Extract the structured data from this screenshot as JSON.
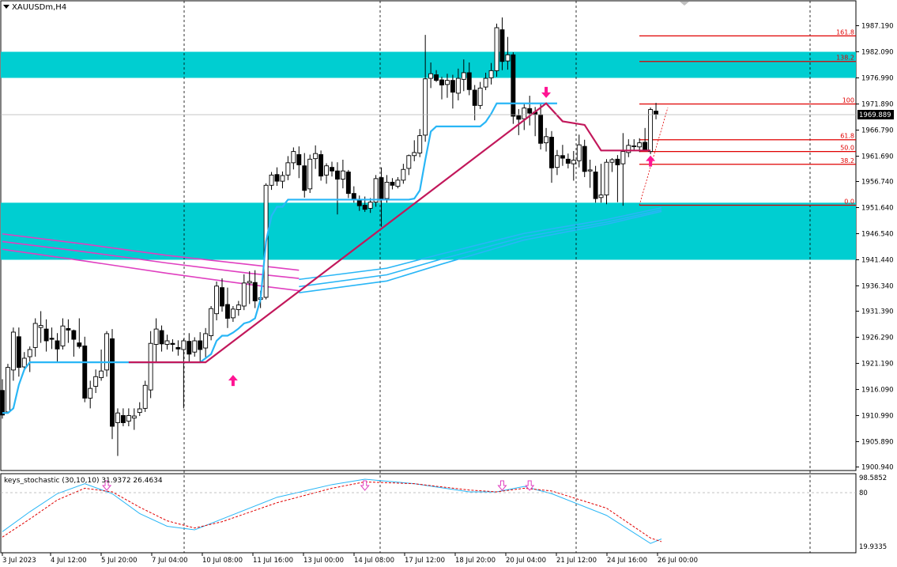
{
  "chart": {
    "symbol_title": "XAUUSDm,H4",
    "current_price": "1969.889",
    "y_ticks": [
      "1987.190",
      "1982.090",
      "1976.990",
      "1971.890",
      "1966.790",
      "1961.690",
      "1956.740",
      "1951.640",
      "1946.540",
      "1941.440",
      "1936.340",
      "1931.390",
      "1926.290",
      "1921.190",
      "1916.090",
      "1910.990",
      "1905.890",
      "1900.940"
    ],
    "fib_labels": [
      "161.8",
      "138.2",
      "100",
      "61.8",
      "50.0",
      "38.2",
      "0.0"
    ]
  },
  "indicator": {
    "title": "keys_stochastic (30,10,10) 31.9372 26.4634",
    "y_top": "98.5852",
    "y_mid": "80",
    "y_bottom": "19.9335"
  },
  "x_axis": {
    "labels": [
      "3 Jul 2023",
      "4 Jul 12:00",
      "5 Jul 20:00",
      "7 Jul 04:00",
      "10 Jul 08:00",
      "11 Jul 16:00",
      "13 Jul 00:00",
      "14 Jul 08:00",
      "17 Jul 12:00",
      "18 Jul 20:00",
      "20 Jul 04:00",
      "21 Jul 12:00",
      "24 Jul 16:00",
      "26 Jul 00:00"
    ]
  },
  "colors": {
    "zone": "#00CED1",
    "support": "#29B6F6",
    "resistance": "#C2185B",
    "fib": "#E00000",
    "ribbon": "#E040C0",
    "arrow": "#FF1493"
  },
  "chart_data": {
    "type": "candlestick",
    "y_range": [
      1900.94,
      1990.0
    ],
    "zones": [
      [
        1976.99,
        1982.09
      ],
      [
        1941.44,
        1952.59
      ]
    ],
    "fib_levels": [
      1985.2,
      1980.2,
      1971.89,
      1964.9,
      1962.6,
      1960.1,
      1952.1
    ],
    "candles": [
      {
        "o": 1915.9,
        "h": 1918.1,
        "l": 1910.4,
        "c": 1911.1
      },
      {
        "o": 1911.7,
        "h": 1921.1,
        "l": 1911.5,
        "c": 1920.4
      },
      {
        "o": 1919.9,
        "h": 1928.2,
        "l": 1917.8,
        "c": 1927.3
      },
      {
        "o": 1926.4,
        "h": 1928.2,
        "l": 1918.6,
        "c": 1920.4
      },
      {
        "o": 1920.5,
        "h": 1923.4,
        "l": 1919.7,
        "c": 1922.2
      },
      {
        "o": 1922.5,
        "h": 1924.5,
        "l": 1919.5,
        "c": 1923.9
      },
      {
        "o": 1924.3,
        "h": 1930.0,
        "l": 1922.5,
        "c": 1929.0
      },
      {
        "o": 1928.2,
        "h": 1931.4,
        "l": 1925.2,
        "c": 1928.6
      },
      {
        "o": 1927.9,
        "h": 1929.8,
        "l": 1923.5,
        "c": 1925.6
      },
      {
        "o": 1926.1,
        "h": 1928.2,
        "l": 1924.0,
        "c": 1925.9
      },
      {
        "o": 1925.6,
        "h": 1927.1,
        "l": 1921.4,
        "c": 1924.0
      },
      {
        "o": 1924.6,
        "h": 1930.0,
        "l": 1923.9,
        "c": 1928.5
      },
      {
        "o": 1928.0,
        "h": 1929.8,
        "l": 1925.2,
        "c": 1927.7
      },
      {
        "o": 1927.6,
        "h": 1927.8,
        "l": 1922.5,
        "c": 1925.9
      },
      {
        "o": 1925.2,
        "h": 1930.0,
        "l": 1924.1,
        "c": 1924.5
      },
      {
        "o": 1924.6,
        "h": 1926.4,
        "l": 1913.6,
        "c": 1914.4
      },
      {
        "o": 1914.4,
        "h": 1917.8,
        "l": 1912.4,
        "c": 1916.3
      },
      {
        "o": 1916.7,
        "h": 1920.0,
        "l": 1915.4,
        "c": 1918.6
      },
      {
        "o": 1918.4,
        "h": 1923.9,
        "l": 1917.8,
        "c": 1919.7
      },
      {
        "o": 1919.9,
        "h": 1927.5,
        "l": 1918.6,
        "c": 1927.0
      },
      {
        "o": 1926.0,
        "h": 1927.9,
        "l": 1906.4,
        "c": 1908.9
      },
      {
        "o": 1909.6,
        "h": 1912.4,
        "l": 1903.1,
        "c": 1911.5
      },
      {
        "o": 1911.0,
        "h": 1912.4,
        "l": 1908.9,
        "c": 1909.6
      },
      {
        "o": 1909.9,
        "h": 1912.4,
        "l": 1908.9,
        "c": 1911.0
      },
      {
        "o": 1910.5,
        "h": 1912.4,
        "l": 1908.2,
        "c": 1910.9
      },
      {
        "o": 1911.6,
        "h": 1913.6,
        "l": 1910.9,
        "c": 1912.3
      },
      {
        "o": 1912.4,
        "h": 1917.8,
        "l": 1911.7,
        "c": 1916.9
      },
      {
        "o": 1916.0,
        "h": 1927.5,
        "l": 1914.4,
        "c": 1925.1
      },
      {
        "o": 1924.9,
        "h": 1930.0,
        "l": 1921.4,
        "c": 1927.9
      },
      {
        "o": 1927.6,
        "h": 1928.6,
        "l": 1923.5,
        "c": 1925.0
      },
      {
        "o": 1924.9,
        "h": 1926.8,
        "l": 1923.9,
        "c": 1925.6
      },
      {
        "o": 1925.1,
        "h": 1925.9,
        "l": 1923.5,
        "c": 1924.9
      },
      {
        "o": 1924.3,
        "h": 1925.7,
        "l": 1922.7,
        "c": 1924.0
      },
      {
        "o": 1923.9,
        "h": 1926.0,
        "l": 1912.4,
        "c": 1925.6
      },
      {
        "o": 1925.5,
        "h": 1927.1,
        "l": 1921.4,
        "c": 1923.0
      },
      {
        "o": 1923.4,
        "h": 1926.3,
        "l": 1922.5,
        "c": 1925.6
      },
      {
        "o": 1925.6,
        "h": 1927.3,
        "l": 1921.5,
        "c": 1923.9
      },
      {
        "o": 1924.2,
        "h": 1928.1,
        "l": 1922.4,
        "c": 1927.0
      },
      {
        "o": 1926.6,
        "h": 1932.4,
        "l": 1925.7,
        "c": 1931.9
      },
      {
        "o": 1930.9,
        "h": 1937.2,
        "l": 1929.6,
        "c": 1936.3
      },
      {
        "o": 1936.0,
        "h": 1937.8,
        "l": 1931.3,
        "c": 1932.4
      },
      {
        "o": 1932.7,
        "h": 1936.0,
        "l": 1928.1,
        "c": 1930.0
      },
      {
        "o": 1930.1,
        "h": 1932.4,
        "l": 1929.3,
        "c": 1931.8
      },
      {
        "o": 1931.7,
        "h": 1933.4,
        "l": 1930.5,
        "c": 1932.6
      },
      {
        "o": 1932.4,
        "h": 1938.6,
        "l": 1931.6,
        "c": 1936.9
      },
      {
        "o": 1936.9,
        "h": 1939.2,
        "l": 1932.8,
        "c": 1937.2
      },
      {
        "o": 1937.0,
        "h": 1939.4,
        "l": 1932.0,
        "c": 1933.4
      },
      {
        "o": 1933.7,
        "h": 1935.4,
        "l": 1932.0,
        "c": 1934.0
      },
      {
        "o": 1934.1,
        "h": 1956.4,
        "l": 1933.7,
        "c": 1956.0
      },
      {
        "o": 1956.0,
        "h": 1958.6,
        "l": 1955.1,
        "c": 1958.0
      },
      {
        "o": 1958.1,
        "h": 1959.5,
        "l": 1955.9,
        "c": 1956.8
      },
      {
        "o": 1956.8,
        "h": 1958.7,
        "l": 1955.4,
        "c": 1957.9
      },
      {
        "o": 1958.0,
        "h": 1961.7,
        "l": 1957.0,
        "c": 1960.4
      },
      {
        "o": 1960.4,
        "h": 1963.4,
        "l": 1959.1,
        "c": 1962.6
      },
      {
        "o": 1962.0,
        "h": 1963.6,
        "l": 1957.4,
        "c": 1960.0
      },
      {
        "o": 1959.8,
        "h": 1962.3,
        "l": 1953.6,
        "c": 1955.0
      },
      {
        "o": 1955.3,
        "h": 1962.0,
        "l": 1954.5,
        "c": 1961.1
      },
      {
        "o": 1961.2,
        "h": 1963.8,
        "l": 1959.2,
        "c": 1962.2
      },
      {
        "o": 1962.0,
        "h": 1962.8,
        "l": 1956.9,
        "c": 1957.8
      },
      {
        "o": 1958.0,
        "h": 1960.3,
        "l": 1956.3,
        "c": 1959.8
      },
      {
        "o": 1959.5,
        "h": 1960.6,
        "l": 1957.7,
        "c": 1958.8
      },
      {
        "o": 1958.8,
        "h": 1960.5,
        "l": 1950.3,
        "c": 1957.2
      },
      {
        "o": 1957.2,
        "h": 1961.0,
        "l": 1955.4,
        "c": 1958.8
      },
      {
        "o": 1958.6,
        "h": 1959.0,
        "l": 1953.5,
        "c": 1954.4
      },
      {
        "o": 1954.4,
        "h": 1955.8,
        "l": 1952.6,
        "c": 1953.2
      },
      {
        "o": 1953.1,
        "h": 1954.0,
        "l": 1951.0,
        "c": 1952.0
      },
      {
        "o": 1952.1,
        "h": 1953.8,
        "l": 1950.8,
        "c": 1951.3
      },
      {
        "o": 1951.5,
        "h": 1953.5,
        "l": 1950.6,
        "c": 1952.7
      },
      {
        "o": 1952.7,
        "h": 1958.0,
        "l": 1951.8,
        "c": 1957.3
      },
      {
        "o": 1957.5,
        "h": 1959.5,
        "l": 1947.9,
        "c": 1953.4
      },
      {
        "o": 1953.4,
        "h": 1958.0,
        "l": 1952.6,
        "c": 1956.6
      },
      {
        "o": 1956.6,
        "h": 1957.4,
        "l": 1955.2,
        "c": 1956.0
      },
      {
        "o": 1955.8,
        "h": 1957.6,
        "l": 1955.4,
        "c": 1957.0
      },
      {
        "o": 1957.0,
        "h": 1960.2,
        "l": 1956.3,
        "c": 1959.1
      },
      {
        "o": 1959.3,
        "h": 1962.0,
        "l": 1958.0,
        "c": 1961.8
      },
      {
        "o": 1961.8,
        "h": 1964.8,
        "l": 1960.7,
        "c": 1962.4
      },
      {
        "o": 1962.3,
        "h": 1967.0,
        "l": 1961.5,
        "c": 1965.7
      },
      {
        "o": 1965.8,
        "h": 1985.4,
        "l": 1964.5,
        "c": 1976.8
      },
      {
        "o": 1976.9,
        "h": 1980.0,
        "l": 1975.0,
        "c": 1977.8
      },
      {
        "o": 1977.6,
        "h": 1978.5,
        "l": 1976.2,
        "c": 1976.5
      },
      {
        "o": 1976.6,
        "h": 1977.2,
        "l": 1972.8,
        "c": 1975.6
      },
      {
        "o": 1975.7,
        "h": 1977.8,
        "l": 1973.1,
        "c": 1976.5
      },
      {
        "o": 1976.5,
        "h": 1977.6,
        "l": 1971.0,
        "c": 1974.2
      },
      {
        "o": 1974.0,
        "h": 1978.8,
        "l": 1972.6,
        "c": 1976.9
      },
      {
        "o": 1976.7,
        "h": 1980.6,
        "l": 1974.4,
        "c": 1978.0
      },
      {
        "o": 1978.0,
        "h": 1980.0,
        "l": 1973.6,
        "c": 1974.7
      },
      {
        "o": 1974.6,
        "h": 1975.6,
        "l": 1968.7,
        "c": 1971.6
      },
      {
        "o": 1971.6,
        "h": 1976.2,
        "l": 1970.9,
        "c": 1975.0
      },
      {
        "o": 1975.2,
        "h": 1978.0,
        "l": 1974.6,
        "c": 1976.9
      },
      {
        "o": 1977.0,
        "h": 1979.9,
        "l": 1975.7,
        "c": 1978.4
      },
      {
        "o": 1978.4,
        "h": 1987.6,
        "l": 1977.2,
        "c": 1986.8
      },
      {
        "o": 1986.4,
        "h": 1988.8,
        "l": 1978.5,
        "c": 1980.2
      },
      {
        "o": 1980.3,
        "h": 1985.0,
        "l": 1978.6,
        "c": 1981.5
      },
      {
        "o": 1981.5,
        "h": 1982.0,
        "l": 1968.0,
        "c": 1969.5
      },
      {
        "o": 1969.6,
        "h": 1970.9,
        "l": 1965.8,
        "c": 1968.9
      },
      {
        "o": 1969.0,
        "h": 1972.1,
        "l": 1966.8,
        "c": 1971.1
      },
      {
        "o": 1971.0,
        "h": 1973.5,
        "l": 1967.7,
        "c": 1970.1
      },
      {
        "o": 1970.3,
        "h": 1971.3,
        "l": 1965.6,
        "c": 1969.8
      },
      {
        "o": 1969.8,
        "h": 1972.0,
        "l": 1963.0,
        "c": 1964.2
      },
      {
        "o": 1964.3,
        "h": 1967.2,
        "l": 1962.6,
        "c": 1965.5
      },
      {
        "o": 1965.4,
        "h": 1966.6,
        "l": 1956.5,
        "c": 1959.4
      },
      {
        "o": 1959.5,
        "h": 1962.9,
        "l": 1958.0,
        "c": 1961.8
      },
      {
        "o": 1961.8,
        "h": 1963.9,
        "l": 1959.8,
        "c": 1961.3
      },
      {
        "o": 1961.1,
        "h": 1962.2,
        "l": 1959.3,
        "c": 1960.3
      },
      {
        "o": 1960.2,
        "h": 1962.7,
        "l": 1956.9,
        "c": 1960.9
      },
      {
        "o": 1960.8,
        "h": 1965.9,
        "l": 1959.5,
        "c": 1963.9
      },
      {
        "o": 1963.6,
        "h": 1964.9,
        "l": 1957.6,
        "c": 1958.7
      },
      {
        "o": 1958.8,
        "h": 1961.0,
        "l": 1955.5,
        "c": 1959.0
      },
      {
        "o": 1958.6,
        "h": 1959.8,
        "l": 1952.6,
        "c": 1953.4
      },
      {
        "o": 1953.6,
        "h": 1960.2,
        "l": 1952.6,
        "c": 1954.1
      },
      {
        "o": 1954.1,
        "h": 1961.1,
        "l": 1952.3,
        "c": 1960.5
      },
      {
        "o": 1960.5,
        "h": 1961.3,
        "l": 1958.6,
        "c": 1961.0
      },
      {
        "o": 1961.1,
        "h": 1961.9,
        "l": 1952.7,
        "c": 1960.0
      },
      {
        "o": 1960.2,
        "h": 1966.2,
        "l": 1952.0,
        "c": 1962.6
      },
      {
        "o": 1962.4,
        "h": 1965.0,
        "l": 1961.5,
        "c": 1963.8
      },
      {
        "o": 1963.7,
        "h": 1965.0,
        "l": 1962.9,
        "c": 1963.7
      },
      {
        "o": 1963.5,
        "h": 1965.2,
        "l": 1962.5,
        "c": 1964.3
      },
      {
        "o": 1964.4,
        "h": 1967.2,
        "l": 1963.3,
        "c": 1962.8
      },
      {
        "o": 1962.6,
        "h": 1971.2,
        "l": 1962.1,
        "c": 1970.8
      },
      {
        "o": 1970.5,
        "h": 1972.1,
        "l": 1968.9,
        "c": 1969.9
      }
    ],
    "support_line": [
      1911.5,
      1911.5,
      1912.4,
      1917.0,
      1920.0,
      1921.4,
      1921.4,
      1921.4,
      1921.4,
      1921.4,
      1921.4,
      1921.4,
      1921.4,
      1921.4,
      1921.4,
      1921.4,
      1921.4,
      1921.4,
      1921.4,
      1921.4,
      1921.4,
      1921.4,
      1921.4,
      1921.4,
      1921.4,
      1921.4,
      1921.4,
      1921.4,
      1921.4,
      1921.4,
      1921.4,
      1921.4,
      1921.4,
      1921.4,
      1921.4,
      1921.4,
      1921.4,
      1922.2,
      1923.0,
      1925.6,
      1926.6,
      1926.6,
      1927.2,
      1928.0,
      1929.0,
      1929.3,
      1930.0,
      1933.7,
      1945.0,
      1950.0,
      1951.8,
      1951.8,
      1953.2,
      1953.2,
      1953.2,
      1953.2,
      1953.2,
      1953.2,
      1953.2,
      1953.2,
      1953.2,
      1953.2,
      1953.2,
      1953.2,
      1953.2,
      1953.2,
      1953.2,
      1953.2,
      1953.2,
      1953.2,
      1953.2,
      1953.2,
      1953.2,
      1953.2,
      1953.2,
      1953.4,
      1955.0,
      1961.0,
      1966.5,
      1967.5,
      1967.5,
      1967.5,
      1967.5,
      1967.5,
      1967.5,
      1967.5,
      1967.5,
      1967.5,
      1968.4,
      1970.0,
      1972.0,
      1972.0,
      1972.0,
      1972.0,
      1972.0,
      1972.0,
      1972.0,
      1972.0,
      1972.0,
      1972.0,
      1972.0,
      1972.0
    ],
    "resistance_line": [
      [
        23,
        1921.4
      ],
      [
        37,
        1921.4
      ],
      [
        99,
        1972.0
      ],
      [
        102,
        1968.5
      ],
      [
        106,
        1967.8
      ],
      [
        109,
        1962.8
      ],
      [
        118,
        1962.8
      ]
    ],
    "ribbon_lines": [
      [
        [
          0,
          1946.5
        ],
        [
          15,
          1944.5
        ],
        [
          30,
          1942.3
        ],
        [
          45,
          1940.5
        ],
        [
          54,
          1939.4
        ]
      ],
      [
        [
          0,
          1945.0
        ],
        [
          15,
          1943.0
        ],
        [
          30,
          1940.8
        ],
        [
          45,
          1938.8
        ],
        [
          54,
          1937.8
        ]
      ],
      [
        [
          0,
          1943.5
        ],
        [
          15,
          1941.2
        ],
        [
          30,
          1938.8
        ],
        [
          45,
          1936.6
        ],
        [
          54,
          1935.4
        ]
      ]
    ],
    "support_bands": [
      [
        [
          54,
          1937.6
        ],
        [
          70,
          1939.8
        ],
        [
          80,
          1942.6
        ],
        [
          95,
          1946.6
        ],
        [
          110,
          1949.3
        ],
        [
          120,
          1951.6
        ]
      ],
      [
        [
          54,
          1936.2
        ],
        [
          70,
          1938.5
        ],
        [
          80,
          1941.6
        ],
        [
          95,
          1945.9
        ],
        [
          110,
          1948.8
        ],
        [
          120,
          1951.2
        ]
      ],
      [
        [
          54,
          1935.0
        ],
        [
          70,
          1937.3
        ],
        [
          80,
          1940.6
        ],
        [
          95,
          1945.3
        ],
        [
          110,
          1948.4
        ],
        [
          120,
          1950.9
        ]
      ]
    ],
    "signal_arrows": [
      {
        "i": 42,
        "dir": "up",
        "price": 1918.0
      },
      {
        "i": 99,
        "dir": "down",
        "price": 1974.0
      },
      {
        "i": 118,
        "dir": "up",
        "price": 1960.9
      }
    ],
    "stochastic": {
      "range": [
        19.9335,
        98.5852
      ],
      "main": [
        [
          0,
          38
        ],
        [
          5,
          60
        ],
        [
          10,
          80
        ],
        [
          15,
          91
        ],
        [
          20,
          80
        ],
        [
          25,
          58
        ],
        [
          30,
          44
        ],
        [
          35,
          40
        ],
        [
          40,
          52
        ],
        [
          50,
          76
        ],
        [
          60,
          90
        ],
        [
          66,
          96
        ],
        [
          75,
          91
        ],
        [
          85,
          82
        ],
        [
          90,
          82
        ],
        [
          95,
          88
        ],
        [
          100,
          80
        ],
        [
          110,
          56
        ],
        [
          118,
          25
        ],
        [
          120,
          30
        ]
      ],
      "signal": [
        [
          0,
          32
        ],
        [
          5,
          52
        ],
        [
          10,
          73
        ],
        [
          15,
          86
        ],
        [
          20,
          82
        ],
        [
          25,
          65
        ],
        [
          30,
          50
        ],
        [
          35,
          42
        ],
        [
          40,
          49
        ],
        [
          50,
          70
        ],
        [
          60,
          86
        ],
        [
          66,
          93
        ],
        [
          75,
          91
        ],
        [
          85,
          84
        ],
        [
          90,
          82
        ],
        [
          95,
          86
        ],
        [
          100,
          83
        ],
        [
          110,
          64
        ],
        [
          118,
          31
        ],
        [
          120,
          27
        ]
      ],
      "arrows": [
        19,
        66,
        91,
        96
      ]
    }
  }
}
